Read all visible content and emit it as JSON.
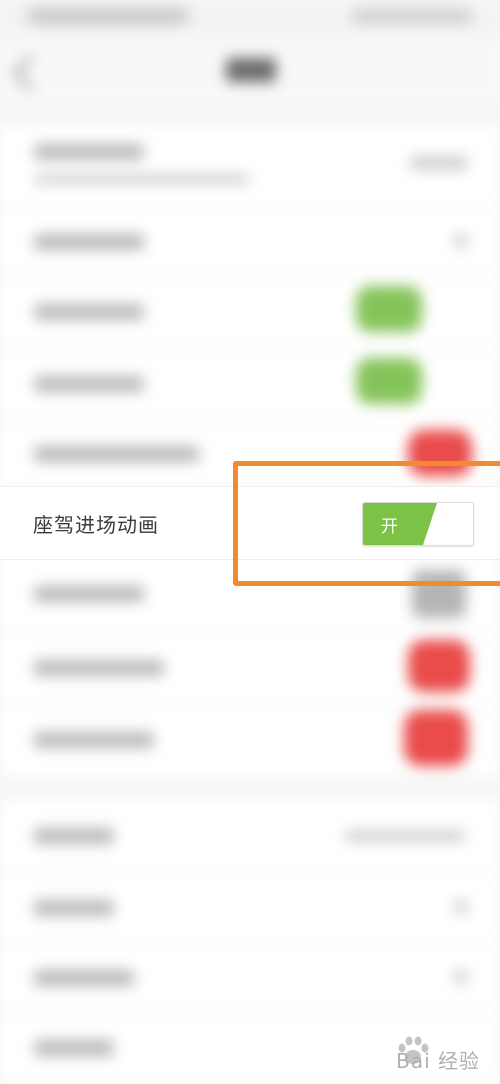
{
  "settings": {
    "highlighted_row": {
      "label": "座驾进场动画",
      "toggle": {
        "state_text": "开",
        "is_on": true
      }
    }
  },
  "colors": {
    "toggle_on": "#7bc246",
    "highlight_border": "#f08c2f",
    "toggle_green_blurred": "#85c45a",
    "toggle_red_blurred": "#ea4b4b"
  },
  "icons": {
    "back": "back-arrow-icon",
    "watermark": "baidu-paw-icon"
  },
  "watermark": {
    "text": "Bai 经验"
  }
}
